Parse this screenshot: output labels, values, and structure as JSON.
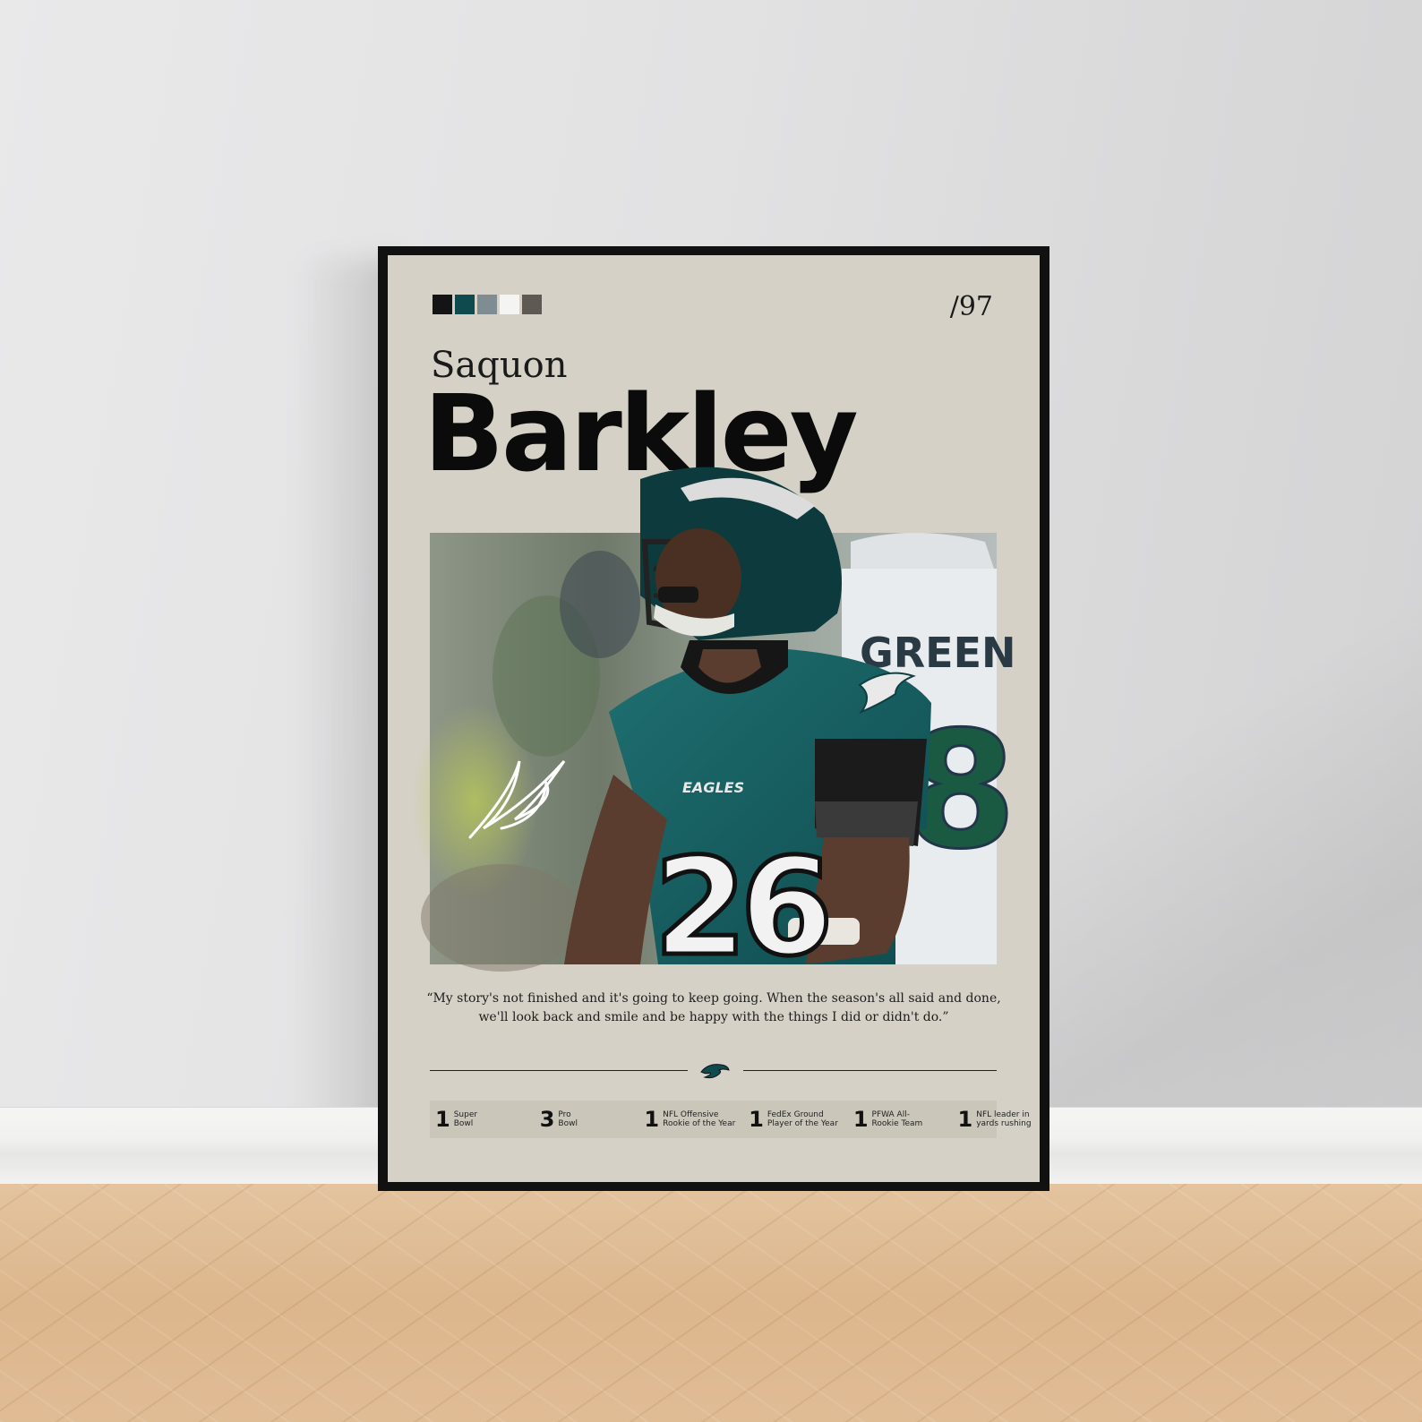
{
  "poster": {
    "swatch_colors": [
      "#141414",
      "#0f4a4f",
      "#7f8c91",
      "#f4f4f2",
      "#5f5953"
    ],
    "number": "/97",
    "first_name": "Saquon",
    "last_name": "Barkley",
    "photo": {
      "jersey_number": "26",
      "jersey_team_text": "EAGLES",
      "background_player_name": "GREEN",
      "background_player_number": "8",
      "signature": "SB"
    },
    "quote_line1": "“My story's not finished and it's going to keep going. When the season's all said and done,",
    "quote_line2": "we'll look back and smile and be happy with the things I did or didn't do.”",
    "stats": [
      {
        "num": "1",
        "label": "Super\nBowl"
      },
      {
        "num": "3",
        "label": "Pro\nBowl"
      },
      {
        "num": "1",
        "label": "NFL Offensive\nRookie of the Year"
      },
      {
        "num": "1",
        "label": "FedEx Ground\nPlayer of the Year"
      },
      {
        "num": "1",
        "label": "PFWA All-\nRookie Team"
      },
      {
        "num": "1",
        "label": "NFL leader in\nyards rushing"
      }
    ]
  }
}
